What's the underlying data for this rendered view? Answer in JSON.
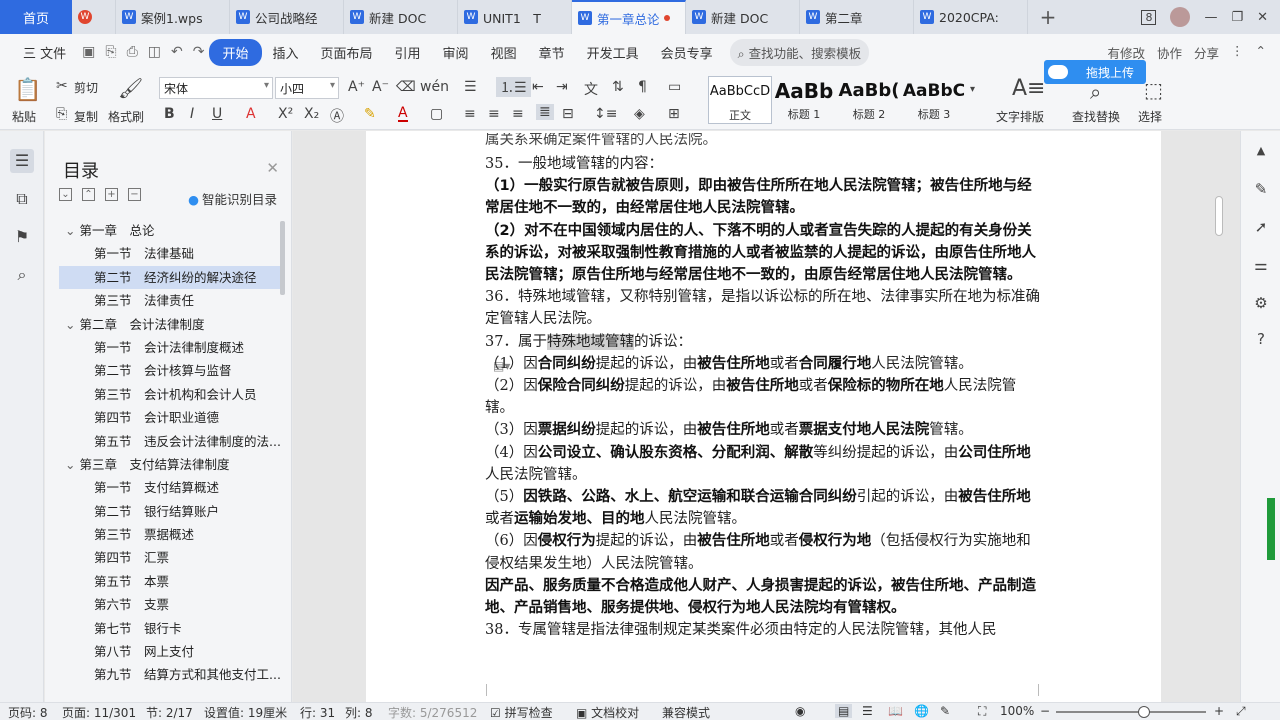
{
  "tabbar": {
    "home": "首页",
    "tabs": [
      {
        "label": "",
        "icon": "wps-logo-icon"
      },
      {
        "label": "案例1.wps",
        "icon": "doc-icon"
      },
      {
        "label": "公司战略经",
        "icon": "doc-icon"
      },
      {
        "label": "新建 DOC",
        "icon": "doc-icon"
      },
      {
        "label": "UNIT1　T",
        "icon": "doc-icon"
      },
      {
        "label": "第一章总论",
        "icon": "doc-icon",
        "active": true
      },
      {
        "label": "新建 DOC",
        "icon": "doc-icon"
      },
      {
        "label": "第二章",
        "icon": "doc-icon"
      },
      {
        "label": "2020CPA:",
        "icon": "doc-icon"
      }
    ],
    "add": "+",
    "page_count_badge": "8"
  },
  "menubar": {
    "file": "三 文件",
    "items": [
      "开始",
      "插入",
      "页面布局",
      "引用",
      "审阅",
      "视图",
      "章节",
      "开发工具",
      "会员专享"
    ],
    "active": "开始",
    "search": "查找功能、搜索模板",
    "right": [
      "有修改",
      "协作",
      "分享"
    ]
  },
  "ribbon": {
    "paste": "粘贴",
    "cut": "剪切",
    "copy": "复制",
    "format_painter": "格式刷",
    "font_name": "宋体",
    "font_size": "小四",
    "styles": [
      {
        "preview": "AaBbCcD",
        "label": "正文"
      },
      {
        "preview": "AaBb",
        "label": "标题 1"
      },
      {
        "preview": "AaBb(",
        "label": "标题 2"
      },
      {
        "preview": "AaBbC",
        "label": "标题 3"
      }
    ],
    "text_layout": "文字排版",
    "find_replace": "查找替换",
    "select": "选择",
    "upload": "拖拽上传"
  },
  "toc": {
    "title": "目录",
    "smart": "智能识别目录",
    "items": [
      {
        "level": 1,
        "text": "第一章　总论"
      },
      {
        "level": 2,
        "text": "第一节　法律基础"
      },
      {
        "level": 2,
        "text": "第二节　经济纠纷的解决途径",
        "selected": true
      },
      {
        "level": 2,
        "text": "第三节　法律责任"
      },
      {
        "level": 1,
        "text": "第二章　会计法律制度"
      },
      {
        "level": 2,
        "text": "第一节　会计法律制度概述"
      },
      {
        "level": 2,
        "text": "第二节　会计核算与监督"
      },
      {
        "level": 2,
        "text": "第三节　会计机构和会计人员"
      },
      {
        "level": 2,
        "text": "第四节　会计职业道德"
      },
      {
        "level": 2,
        "text": "第五节　违反会计法律制度的法..."
      },
      {
        "level": 1,
        "text": "第三章　支付结算法律制度"
      },
      {
        "level": 2,
        "text": "第一节　支付结算概述"
      },
      {
        "level": 2,
        "text": "第二节　银行结算账户"
      },
      {
        "level": 2,
        "text": "第三节　票据概述"
      },
      {
        "level": 2,
        "text": "第四节　汇票"
      },
      {
        "level": 2,
        "text": "第五节　本票"
      },
      {
        "level": 2,
        "text": "第六节　支票"
      },
      {
        "level": 2,
        "text": "第七节　银行卡"
      },
      {
        "level": 2,
        "text": "第八节　网上支付"
      },
      {
        "level": 2,
        "text": "第九节　结算方式和其他支付工..."
      }
    ]
  },
  "document": {
    "top_cut": "属关系来确定案件管辖的人民法院。",
    "p35": "35．一般地域管辖的内容：",
    "p35_1": "（1）一般实行原告就被告原则，即由被告住所所在地人民法院管辖；被告住所地与经常居住地不一致的，由经常居住地人民法院管辖。",
    "p35_2": "（2）对不在中国领域内居住的人、下落不明的人或者宣告失踪的人提起的有关身份关系的诉讼，对被采取强制性教育措施的人或者被监禁的人提起的诉讼，由原告住所地人民法院管辖；原告住所地与经常居住地不一致的，由原告经常居住地人民法院管辖。",
    "p36": "36．特殊地域管辖，又称特别管辖，是指以诉讼标的所在地、法律事实所在地为标准确定管辖人民法院。",
    "p37_a": "37．属于",
    "p37_hl": "特殊地域管辖",
    "p37_b": "的诉讼：",
    "p37_1": [
      "（1）因",
      "合同纠纷",
      "提起的诉讼，由",
      "被告住所地",
      "或者",
      "合同履行地",
      "人民法院管辖。"
    ],
    "p37_2": [
      "（2）因",
      "保险合同纠纷",
      "提起的诉讼，由",
      "被告住所地",
      "或者",
      "保险标的物所在地",
      "人民法院管辖。"
    ],
    "p37_3": [
      "（3）因",
      "票据纠纷",
      "提起的诉讼，由",
      "被告住所地",
      "或者",
      "票据支付地人民法院",
      "管辖。"
    ],
    "p37_4": [
      "（4）因",
      "公司设立、确认股东资格、分配利润、解散",
      "等纠纷提起的诉讼，由",
      "公司住所地",
      "人民法院管辖。"
    ],
    "p37_5": [
      "（5）",
      "因铁路、公路、水上、航空运输和联合运输合同纠纷",
      "引起的诉讼，由",
      "被告住所地",
      "或者",
      "运输始发地、目的地",
      "人民法院管辖。"
    ],
    "p37_6": [
      "（6）因",
      "侵权行为",
      "提起的诉讼，由",
      "被告住所地",
      "或者",
      "侵权行为地",
      "（包括侵权行为实施地和侵权结果发生地）人民法院管辖。"
    ],
    "p37_7": "因产品、服务质量不合格造成他人财产、人身损害提起的诉讼，被告住所地、产品制造地、产品销售地、服务提供地、侵权行为地人民法院均有管辖权。",
    "p38": "38．专属管辖是指法律强制规定某类案件必须由特定的人民法院管辖，其他人民"
  },
  "status": {
    "page": "页码: 8",
    "pages": "页面: 11/301",
    "section": "节: 2/17",
    "setting": "设置值: 19厘米",
    "row": "行: 31",
    "col": "列: 8",
    "words": "字数: 5/276512",
    "spell": "拼写检查",
    "proof": "文档校对",
    "compat": "兼容模式",
    "zoom": "100%"
  }
}
